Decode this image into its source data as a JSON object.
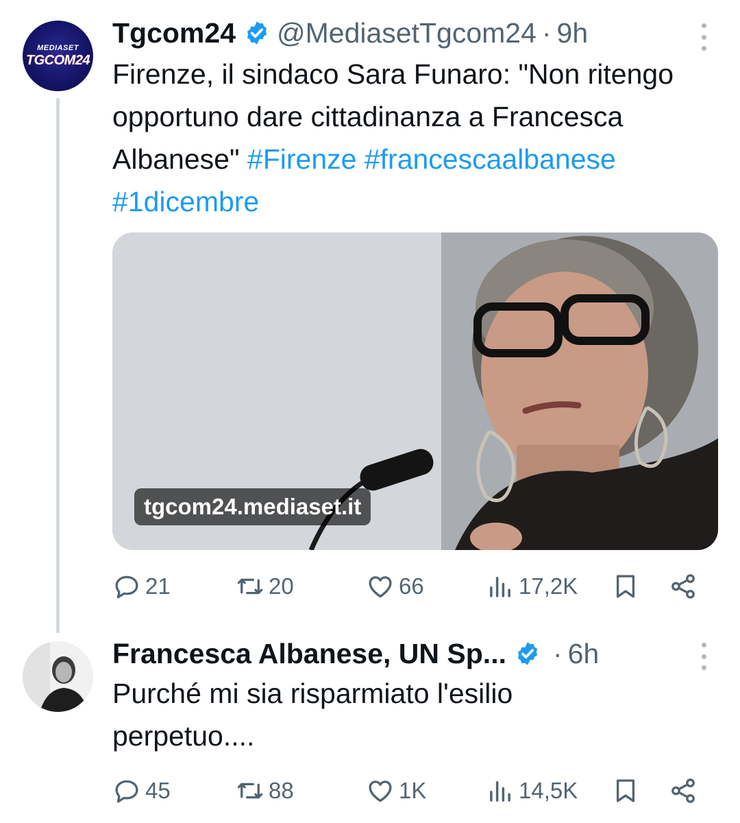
{
  "tweets": [
    {
      "avatar": {
        "brand_top": "MEDIASET",
        "brand_bottom": "TGCOM24"
      },
      "name": "Tgcom24",
      "handle": "@MediasetTgcom24",
      "separator": "·",
      "time": "9h",
      "text_parts": [
        "Firenze, il sindaco Sara Funaro: \"Non ritengo opportuno dare cittadinanza a Francesca Albanese\"  ",
        "#Firenze",
        " ",
        "#francescaalbanese",
        " ",
        "#1dicembre"
      ],
      "link_card_domain": "tgcom24.mediaset.it",
      "counts": {
        "replies": "21",
        "reposts": "20",
        "likes": "66",
        "views": "17,2K"
      }
    },
    {
      "name": "Francesca Albanese, UN Sp...",
      "separator": "·",
      "time": "6h",
      "text": "Purché mi sia risparmiato l'esilio perpetuo....",
      "counts": {
        "replies": "45",
        "reposts": "88",
        "likes": "1K",
        "views": "14,5K"
      }
    }
  ],
  "colors": {
    "accent": "#1d9bf0",
    "text": "#0f1419",
    "secondary": "#536471",
    "thread_line": "#cfd9de"
  },
  "icons": [
    "verified-badge-icon",
    "more-icon",
    "reply-icon",
    "repost-icon",
    "like-icon",
    "views-icon",
    "bookmark-icon",
    "share-icon"
  ]
}
